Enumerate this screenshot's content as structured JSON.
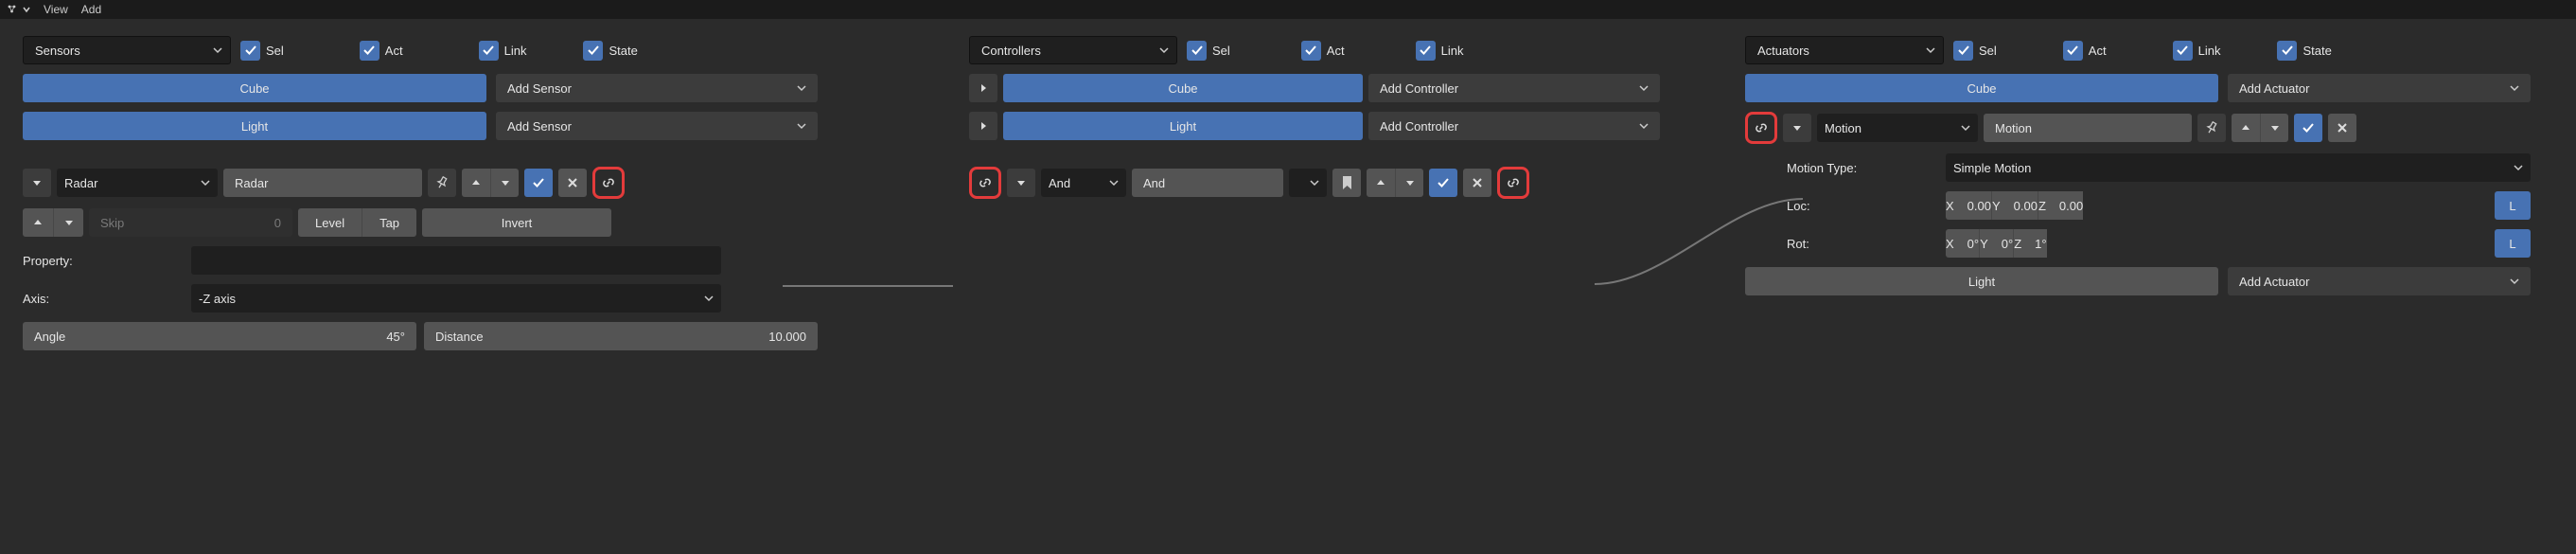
{
  "header": {
    "menu_view": "View",
    "menu_add": "Add"
  },
  "common": {
    "chk_sel": "Sel",
    "chk_act": "Act",
    "chk_link": "Link",
    "chk_state": "State"
  },
  "sensors": {
    "title": "Sensors",
    "objects": [
      {
        "name": "Cube",
        "add": "Add Sensor"
      },
      {
        "name": "Light",
        "add": "Add Sensor"
      }
    ],
    "brick": {
      "type": "Radar",
      "name": "Radar",
      "skip_label": "Skip",
      "skip_value": "0",
      "level": "Level",
      "tap": "Tap",
      "invert": "Invert",
      "property_label": "Property:",
      "axis_label": "Axis:",
      "axis_value": "-Z axis",
      "angle_label": "Angle",
      "angle_value": "45°",
      "distance_label": "Distance",
      "distance_value": "10.000"
    }
  },
  "controllers": {
    "title": "Controllers",
    "objects": [
      {
        "name": "Cube",
        "add": "Add Controller"
      },
      {
        "name": "Light",
        "add": "Add Controller"
      }
    ],
    "brick": {
      "type": "And",
      "name": "And"
    }
  },
  "actuators": {
    "title": "Actuators",
    "objects_cube": "Cube",
    "add_cube": "Add Actuator",
    "objects_light": "Light",
    "add_light": "Add Actuator",
    "brick": {
      "type": "Motion",
      "name": "Motion",
      "motion_type_label": "Motion Type:",
      "motion_type_value": "Simple Motion",
      "loc_label": "Loc:",
      "rot_label": "Rot:",
      "loc": {
        "xl": "X",
        "x": "0.00",
        "yl": "Y",
        "y": "0.00",
        "zl": "Z",
        "z": "0.00",
        "L": "L"
      },
      "rot": {
        "xl": "X",
        "x": "0°",
        "yl": "Y",
        "y": "0°",
        "zl": "Z",
        "z": "1°",
        "L": "L"
      }
    }
  }
}
